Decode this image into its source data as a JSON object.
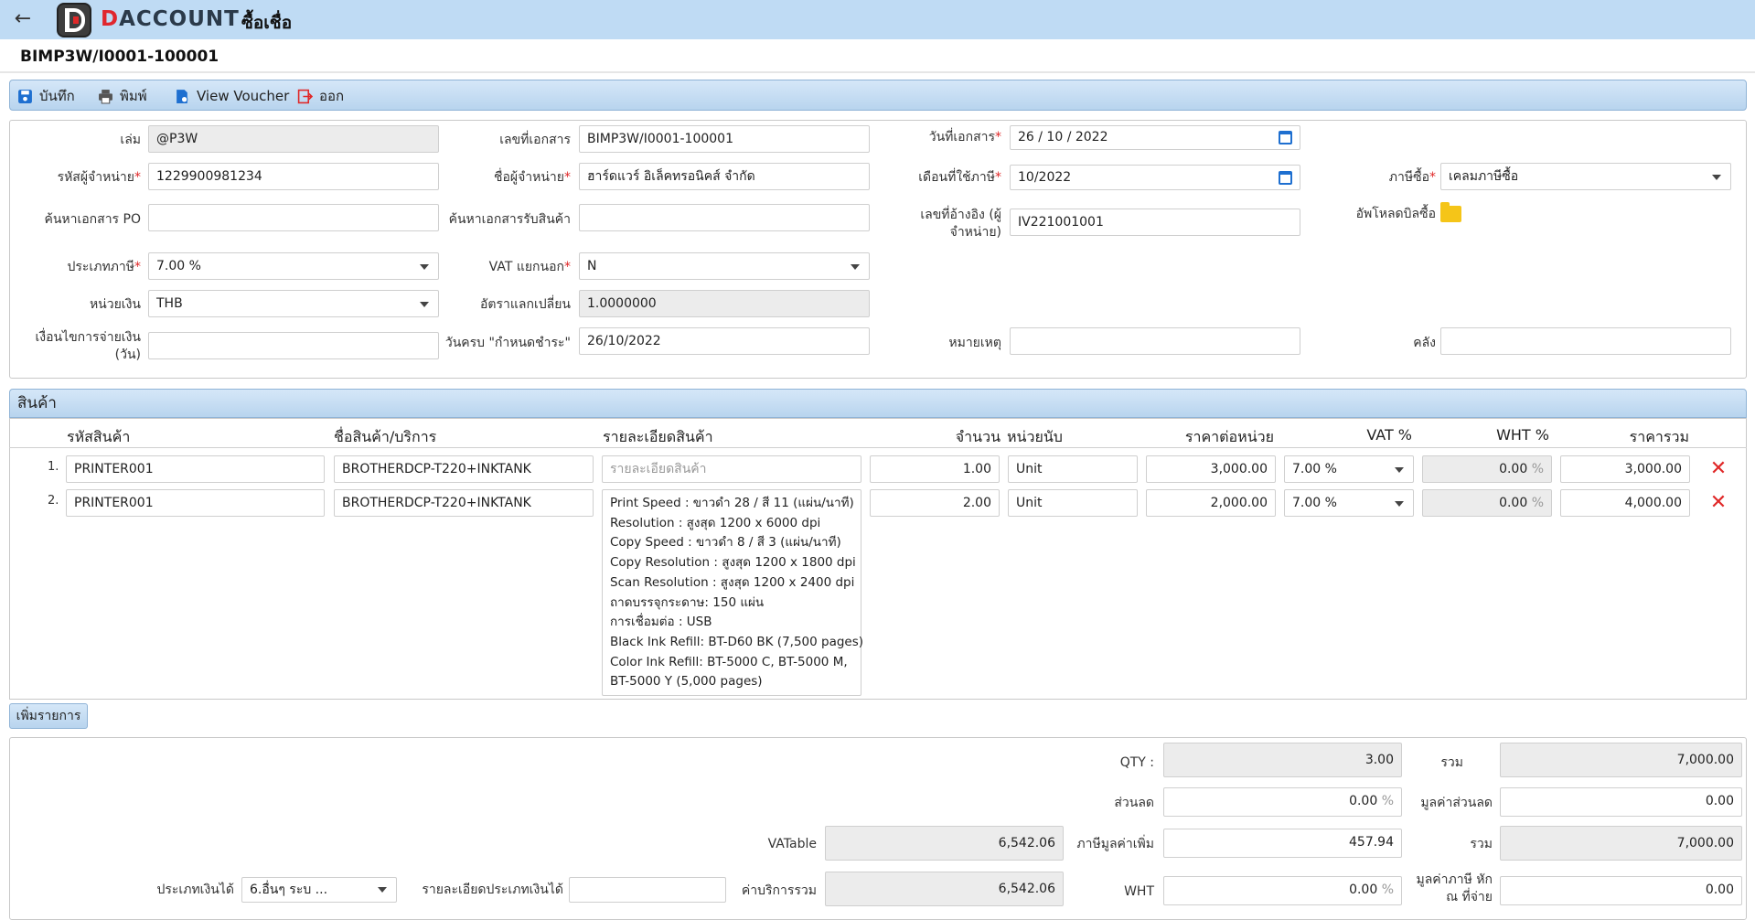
{
  "app": {
    "brand_d": "D",
    "brand_rest": "ACCOUNT",
    "page_title": "ซื้อเชื่อ",
    "doc_title": "BIMP3W/I0001-100001",
    "accent": "#bfdbf4",
    "danger": "#e02828"
  },
  "toolbar": {
    "save": "บันทึก",
    "print": "พิมพ์",
    "view_voucher": "View Voucher",
    "exit": "ออก"
  },
  "form": {
    "book_label": "เล่ม",
    "book_value": "@P3W",
    "docno_label": "เลขที่เอกสาร",
    "docno_value": "BIMP3W/I0001-100001",
    "docdate_label": "วันที่เอกสาร",
    "docdate_value": "26 / 10 /  2022",
    "vendor_code_label": "รหัสผู้จำหน่าย",
    "vendor_code_value": "1229900981234",
    "vendor_name_label": "ชื่อผู้จำหน่าย",
    "vendor_name_value": "ฮาร์ดแวร์ อิเล็คทรอนิคส์ จำกัด",
    "tax_month_label": "เดือนที่ใช้ภาษี",
    "tax_month_value": "10/2022",
    "purchase_tax_label": "ภาษีซื้อ",
    "purchase_tax_value": "เคลมภาษีซื้อ",
    "po_search_label": "ค้นหาเอกสาร PO",
    "po_search_value": "",
    "receipt_search_label": "ค้นหาเอกสารรับสินค้า",
    "receipt_search_value": "",
    "ref_label_1": "เลขที่อ้างอิง (ผู้",
    "ref_label_2": "จำหน่าย)",
    "ref_value": "IV221001001",
    "upload_label": "อัพโหลดบิลซื้อ",
    "tax_type_label": "ประเภทภาษี",
    "tax_type_value": "7.00 %",
    "vat_sep_label": "VAT แยกนอก",
    "vat_sep_value": "N",
    "currency_label": "หน่วยเงิน",
    "currency_value": "THB",
    "rate_label": "อัตราแลกเปลี่ยน",
    "rate_value": "1.0000000",
    "terms_label_1": "เงื่อนไขการจ่ายเงิน",
    "terms_label_2": "(วัน)",
    "terms_value": "",
    "due_label": "วันครบ \"กำหนดชำระ\"",
    "due_value": "26/10/2022",
    "remark_label": "หมายเหตุ",
    "remark_value": "",
    "warehouse_label": "คลัง",
    "warehouse_value": "",
    "required_mark": "*"
  },
  "items": {
    "section_title": "สินค้า",
    "columns": [
      "รหัสสินค้า",
      "ชื่อสินค้า/บริการ",
      "รายละเอียดสินค้า",
      "จำนวน",
      "หน่วยนับ",
      "ราคาต่อหน่วย",
      "VAT %",
      "WHT %",
      "ราคารวม"
    ],
    "rows": [
      {
        "no": "1.",
        "code": "PRINTER001",
        "name": "BROTHERDCP-T220+INKTANK",
        "desc_placeholder": "รายละเอียดสินค้า",
        "desc": [],
        "qty": "1.00",
        "unit": "Unit",
        "price": "3,000.00",
        "vat": "7.00 %",
        "wht": "0.00",
        "total": "3,000.00"
      },
      {
        "no": "2.",
        "code": "PRINTER001",
        "name": "BROTHERDCP-T220+INKTANK",
        "desc_placeholder": "",
        "desc": [
          "Print Speed : ขาวดำ 28 / สี 11 (แผ่น/นาที)",
          "Resolution : สูงสุด 1200 x 6000 dpi",
          "Copy Speed : ขาวดำ 8 / สี 3 (แผ่น/นาที)",
          "Copy Resolution : สูงสุด 1200 x 1800 dpi",
          "Scan Resolution : สูงสุด 1200 x 2400 dpi",
          "ถาดบรรจุกระดาษ: 150 แผ่น",
          "การเชื่อมต่อ : USB",
          "Black Ink Refill: BT-D60 BK (7,500 pages)",
          "Color Ink Refill: BT-5000 C, BT-5000 M,",
          "BT-5000 Y (5,000 pages)"
        ],
        "qty": "2.00",
        "unit": "Unit",
        "price": "2,000.00",
        "vat": "7.00 %",
        "wht": "0.00",
        "total": "4,000.00"
      }
    ],
    "add_button": "เพิ่มรายการ",
    "pct": "%"
  },
  "summary": {
    "qty_label": "QTY :",
    "qty_value": "3.00",
    "sum_label": "รวม",
    "sum_value": "7,000.00",
    "discount_label": "ส่วนลด",
    "discount_value": "0.00",
    "discount_amount_label": "มูลค่าส่วนลด",
    "discount_amount_value": "0.00",
    "vatable_label": "VATable",
    "vatable_value": "6,542.06",
    "vat_label": "ภาษีมูลค่าเพิ่ม",
    "vat_value": "457.94",
    "sum2_label": "รวม",
    "sum2_value": "7,000.00",
    "income_type_label": "ประเภทเงินได้",
    "income_type_value": "6.อื่นๆ ระบ ...",
    "income_desc_label": "รายละเอียดประเภทเงินได้",
    "income_desc_value": "",
    "service_total_label": "ค่าบริการรวม",
    "service_total_value": "6,542.06",
    "wht_label": "WHT",
    "wht_value": "0.00",
    "wht_amount_label_1": "มูลค่าภาษี หัก",
    "wht_amount_label_2": "ณ ที่จ่าย",
    "wht_amount_value": "0.00"
  }
}
